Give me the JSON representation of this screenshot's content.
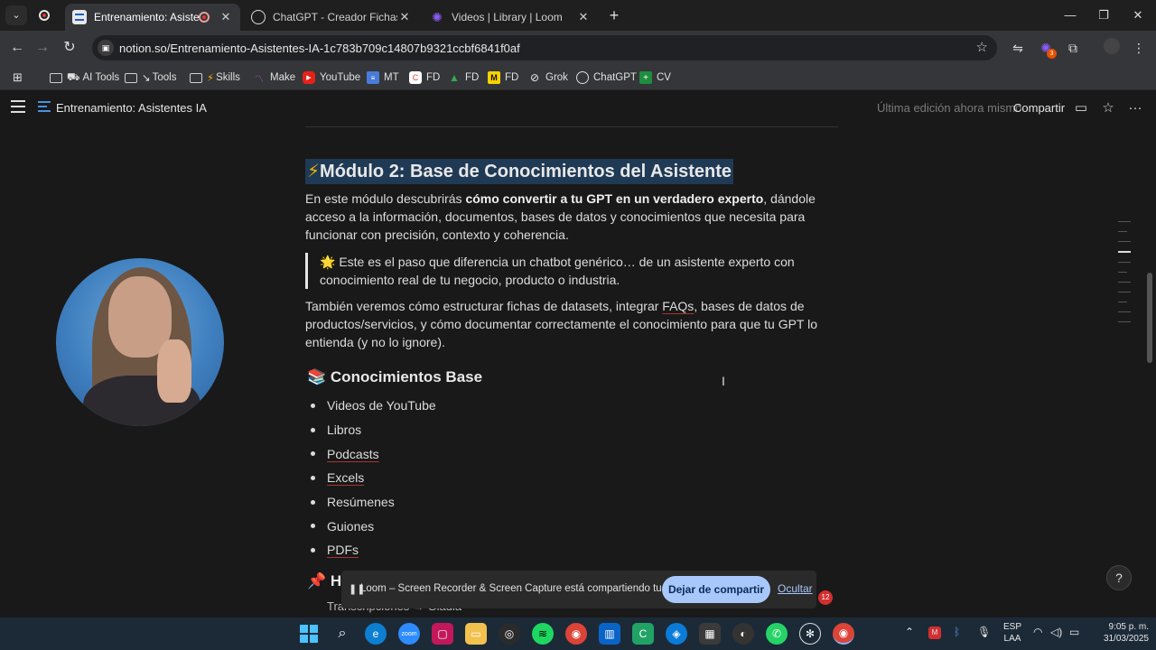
{
  "browser": {
    "tabs": [
      {
        "title": "Entrenamiento: Asistentes I",
        "active": true
      },
      {
        "title": "ChatGPT - Creador Fichas Técni",
        "active": false
      },
      {
        "title": "Videos | Library | Loom",
        "active": false
      }
    ],
    "url": "notion.so/Entrenamiento-Asistentes-IA-1c783b709c14807b9321ccbf6841f0af",
    "extension_badge": "3",
    "bookmarks": [
      "AI Tools",
      "Tools",
      "Skills",
      "Make",
      "YouTube",
      "MT",
      "FD",
      "FD",
      "FD",
      "Grok",
      "ChatGPT",
      "CV"
    ]
  },
  "notion": {
    "page_title": "Entrenamiento: Asistentes IA",
    "last_edit": "Última edición ahora mismo",
    "share_label": "Compartir"
  },
  "content": {
    "h2": "Módulo 2: Base de Conocimientos del Asistente",
    "h2_icon": "⚡",
    "intro_pre": "En este módulo descubrirás ",
    "intro_bold": "cómo convertir a tu GPT en un verdadero experto",
    "intro_post": ", dándole acceso a la información, documentos, bases de datos y conocimientos que necesita para funcionar con precisión, contexto y coherencia.",
    "quote_icon": "🌟",
    "quote": "Este es el paso que diferencia un chatbot genérico… de un asistente experto con conocimiento real de tu negocio, producto o industria.",
    "p2_pre": "También veremos cómo estructurar fichas de datasets, integrar ",
    "p2_link": "FAQs",
    "p2_post": ", bases de datos de productos/servicios, y cómo documentar correctamente el conocimiento para que tu GPT lo entienda (y no lo ignore).",
    "h3_icon": "📚",
    "h3": "Conocimientos Base",
    "bullets": [
      {
        "text": "Videos de YouTube",
        "link": false
      },
      {
        "text": "Libros",
        "link": false
      },
      {
        "text": "Podcasts",
        "link": true
      },
      {
        "text": "Excels",
        "link": true
      },
      {
        "text": "Resúmenes",
        "link": false
      },
      {
        "text": "Guiones",
        "link": false
      },
      {
        "text": "PDFs",
        "link": true
      }
    ],
    "next_h3_icon": "📌",
    "next_h3": "H",
    "next_item": "Transcripciones → Gladia"
  },
  "loom": {
    "message": "Loom – Screen Recorder & Screen Capture está compartiendo tu pantalla.",
    "stop_label": "Dejar de compartir",
    "hide_label": "Ocultar",
    "notification_count": "12"
  },
  "taskbar": {
    "lang": "ESP",
    "lang_sub": "LAA",
    "time": "9:05 p. m.",
    "date": "31/03/2025"
  },
  "colors": {
    "h2_highlight": "#1f3a55",
    "loom_button": "#a8c7fa",
    "taskbar": "#1c2a38"
  }
}
